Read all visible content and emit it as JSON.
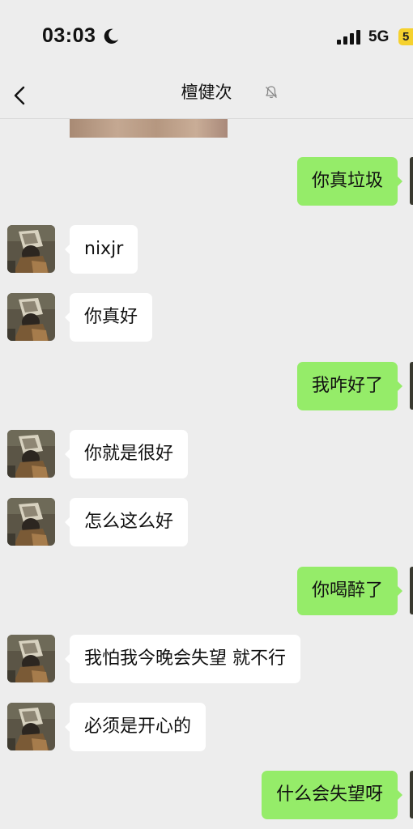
{
  "status_bar": {
    "time": "03:03",
    "network": "5G",
    "battery": "5",
    "icons": [
      "moon-icon",
      "signal-icon",
      "battery-icon"
    ]
  },
  "header": {
    "title": "檀健次",
    "back_icon": "chevron-left-icon",
    "mute_icon": "bell-muted-icon"
  },
  "colors": {
    "background": "#ededed",
    "outgoing_bubble": "#95ec69",
    "incoming_bubble": "#ffffff",
    "battery": "#f5d12e"
  },
  "messages": [
    {
      "side": "out",
      "text": "你真垃圾"
    },
    {
      "side": "in",
      "text": "nixjr"
    },
    {
      "side": "in",
      "text": "你真好"
    },
    {
      "side": "out",
      "text": "我咋好了"
    },
    {
      "side": "in",
      "text": "你就是很好"
    },
    {
      "side": "in",
      "text": "怎么这么好"
    },
    {
      "side": "out",
      "text": "你喝醉了"
    },
    {
      "side": "in",
      "text": "我怕我今晚会失望 就不行"
    },
    {
      "side": "in",
      "text": "必须是开心的"
    },
    {
      "side": "out",
      "text": "什么会失望呀"
    }
  ]
}
